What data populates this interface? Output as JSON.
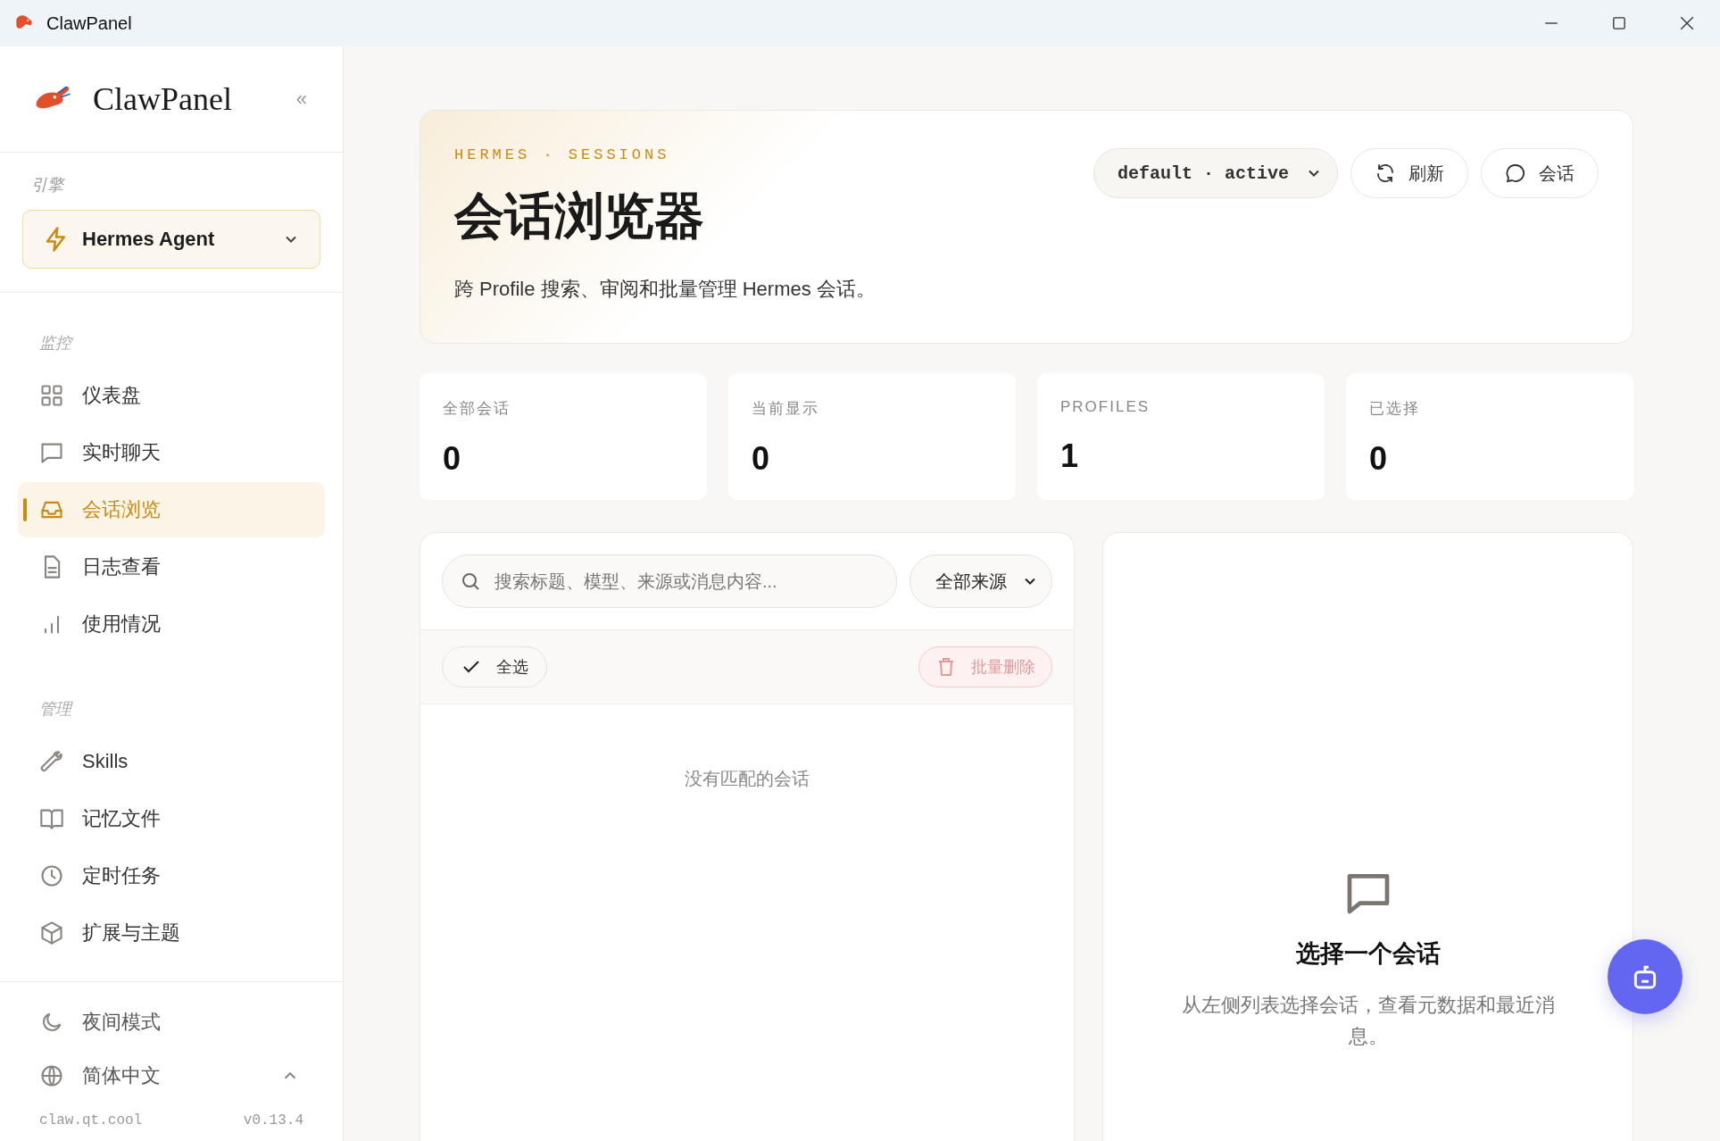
{
  "window": {
    "title": "ClawPanel"
  },
  "sidebar": {
    "brand": "ClawPanel",
    "collapse": "«",
    "engine_label": "引擎",
    "engine": "Hermes Agent",
    "sections": [
      {
        "title": "监控",
        "items": [
          {
            "label": "仪表盘",
            "kind": "grid",
            "selected": false
          },
          {
            "label": "实时聊天",
            "kind": "chat",
            "selected": false
          },
          {
            "label": "会话浏览",
            "kind": "inbox",
            "selected": true
          },
          {
            "label": "日志查看",
            "kind": "file",
            "selected": false
          },
          {
            "label": "使用情况",
            "kind": "bars",
            "selected": false
          }
        ]
      },
      {
        "title": "管理",
        "items": [
          {
            "label": "Skills",
            "kind": "wrench",
            "selected": false
          },
          {
            "label": "记忆文件",
            "kind": "book",
            "selected": false
          },
          {
            "label": "定时任务",
            "kind": "clock",
            "selected": false
          },
          {
            "label": "扩展与主题",
            "kind": "box",
            "selected": false
          }
        ]
      }
    ],
    "footer_items": [
      {
        "label": "夜间模式",
        "kind": "moon",
        "expanded": false
      },
      {
        "label": "简体中文",
        "kind": "globe",
        "expanded": true
      }
    ],
    "site": "claw.qt.cool",
    "version": "v0.13.4"
  },
  "header": {
    "eyebrow": "HERMES · SESSIONS",
    "title": "会话浏览器",
    "description": "跨 Profile 搜索、审阅和批量管理 Hermes 会话。",
    "profile_select": "default · active",
    "buttons": [
      {
        "label": "刷新",
        "kind": "refresh"
      },
      {
        "label": "会话",
        "kind": "chat"
      }
    ]
  },
  "stats": [
    {
      "label": "全部会话",
      "value": "0"
    },
    {
      "label": "当前显示",
      "value": "0"
    },
    {
      "label": "PROFILES",
      "value": "1"
    },
    {
      "label": "已选择",
      "value": "0"
    }
  ],
  "list": {
    "search": {
      "placeholder": "搜索标题、模型、来源或消息内容..."
    },
    "source_filter": "全部来源",
    "select_all": "全选",
    "bulk_delete": {
      "label": "批量删除",
      "disabled": true
    },
    "empty": "没有匹配的会话"
  },
  "detail": {
    "title": "选择一个会话",
    "text": "从左侧列表选择会话，查看元数据和最近消息。"
  }
}
